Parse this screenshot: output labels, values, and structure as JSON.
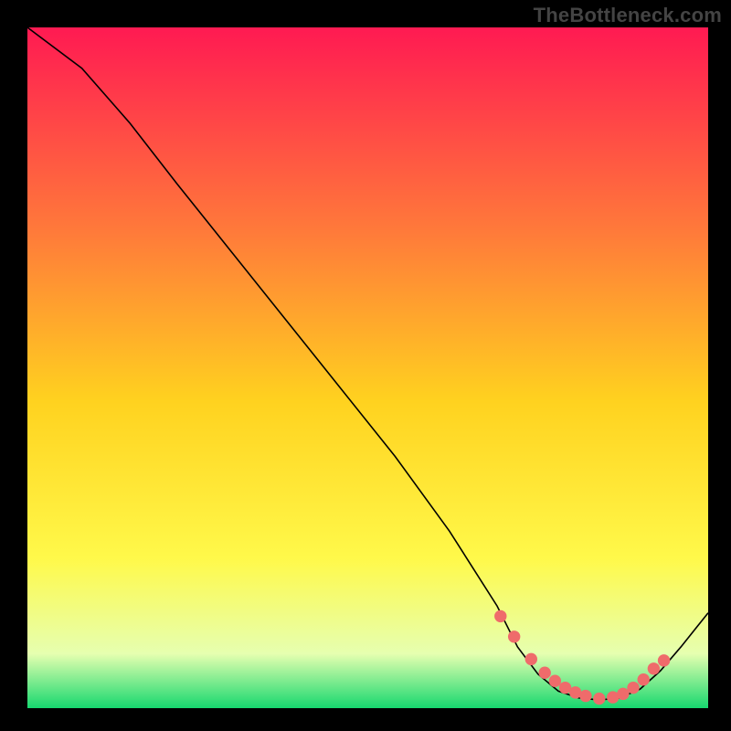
{
  "watermark": "TheBottleneck.com",
  "colors": {
    "gradient_top": "#ff1a52",
    "gradient_mid1": "#ff7a3a",
    "gradient_mid2": "#ffd21f",
    "gradient_mid3": "#fff94a",
    "gradient_low": "#e6ffb0",
    "gradient_bottom": "#17d86f",
    "line": "#000000",
    "marker": "#ef6b6b",
    "frame": "#000000"
  },
  "chart_data": {
    "type": "line",
    "title": "",
    "xlabel": "",
    "ylabel": "",
    "xlim": [
      0,
      100
    ],
    "ylim": [
      0,
      100
    ],
    "series": [
      {
        "name": "curve",
        "x": [
          0,
          8,
          15,
          22,
          30,
          38,
          46,
          54,
          62,
          69,
          72,
          75,
          78,
          81,
          84,
          87,
          90,
          93,
          96,
          100
        ],
        "y": [
          100,
          94,
          86,
          77,
          67,
          57,
          47,
          37,
          26,
          15,
          9,
          5,
          2.5,
          1.5,
          1.2,
          1.5,
          2.8,
          5.5,
          9,
          14
        ]
      }
    ],
    "markers": {
      "name": "trough-points",
      "x": [
        69.5,
        71.5,
        74,
        76,
        77.5,
        79,
        80.5,
        82,
        84,
        86,
        87.5,
        89,
        90.5,
        92,
        93.5
      ],
      "y": [
        13.5,
        10.5,
        7.2,
        5.2,
        4.0,
        3.0,
        2.3,
        1.8,
        1.4,
        1.6,
        2.1,
        3.0,
        4.2,
        5.8,
        7.0
      ]
    }
  }
}
